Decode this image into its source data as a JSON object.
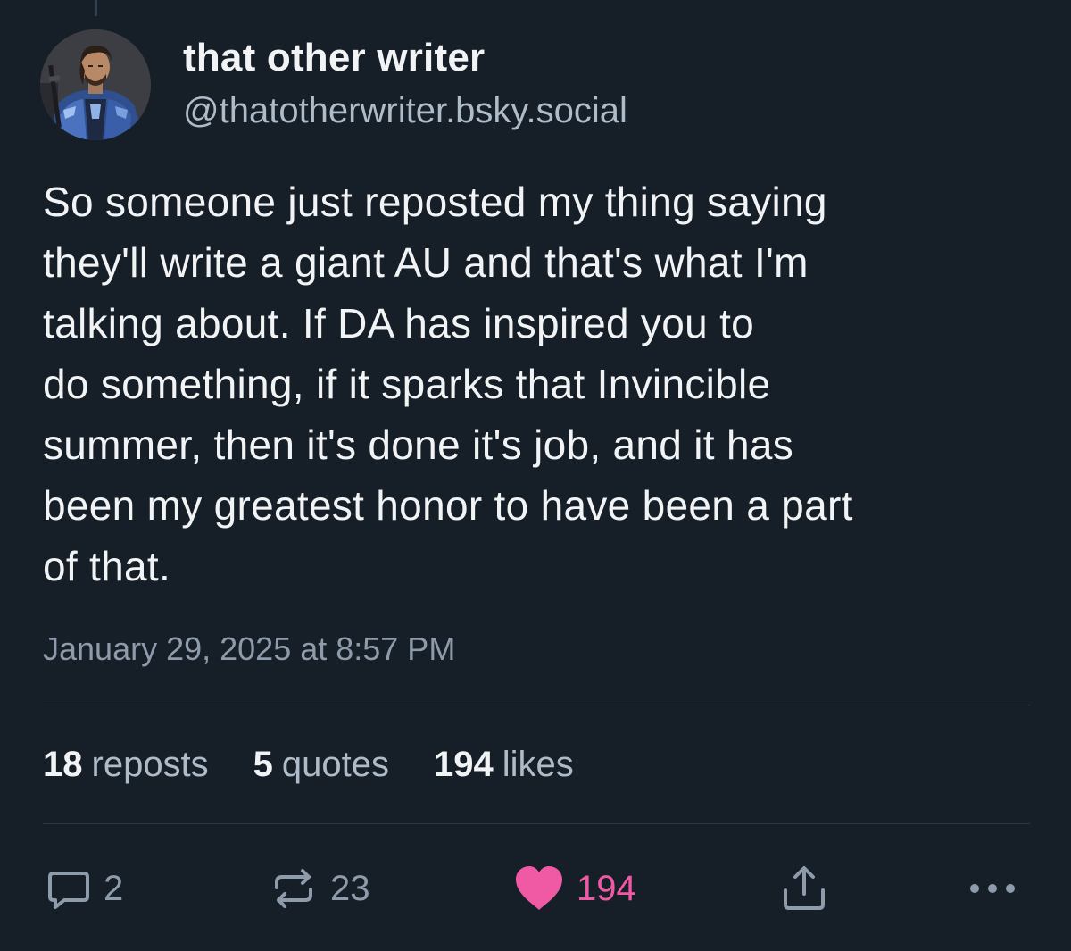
{
  "author": {
    "display_name": "that other writer",
    "handle": "@thatotherwriter.bsky.social",
    "avatar": "avatar-armored-character"
  },
  "post": {
    "text": "So someone just reposted my thing saying\nthey'll write a giant AU and that's what I'm\ntalking about. If DA has inspired you to\ndo something, if it sparks that Invincible\nsummer, then it's done it's job, and it has\nbeen my greatest honor to have been a part\nof that.",
    "timestamp": "January 29, 2025 at 8:57 PM"
  },
  "stats": {
    "reposts": {
      "count": "18",
      "label": "reposts"
    },
    "quotes": {
      "count": "5",
      "label": "quotes"
    },
    "likes": {
      "count": "194",
      "label": "likes"
    }
  },
  "actions": {
    "reply": {
      "icon": "reply-bubble-icon",
      "count": "2"
    },
    "repost": {
      "icon": "repost-arrows-icon",
      "count": "23"
    },
    "like": {
      "icon": "heart-icon",
      "count": "194",
      "liked": true
    },
    "share": {
      "icon": "share-icon"
    },
    "more": {
      "icon": "more-dots-icon"
    }
  },
  "colors": {
    "background": "#161e27",
    "text_primary": "#f1f3f5",
    "text_secondary": "#aebbc9",
    "text_muted": "#8e9bab",
    "like_accent": "#f05aa5",
    "divider": "#2c3742"
  }
}
